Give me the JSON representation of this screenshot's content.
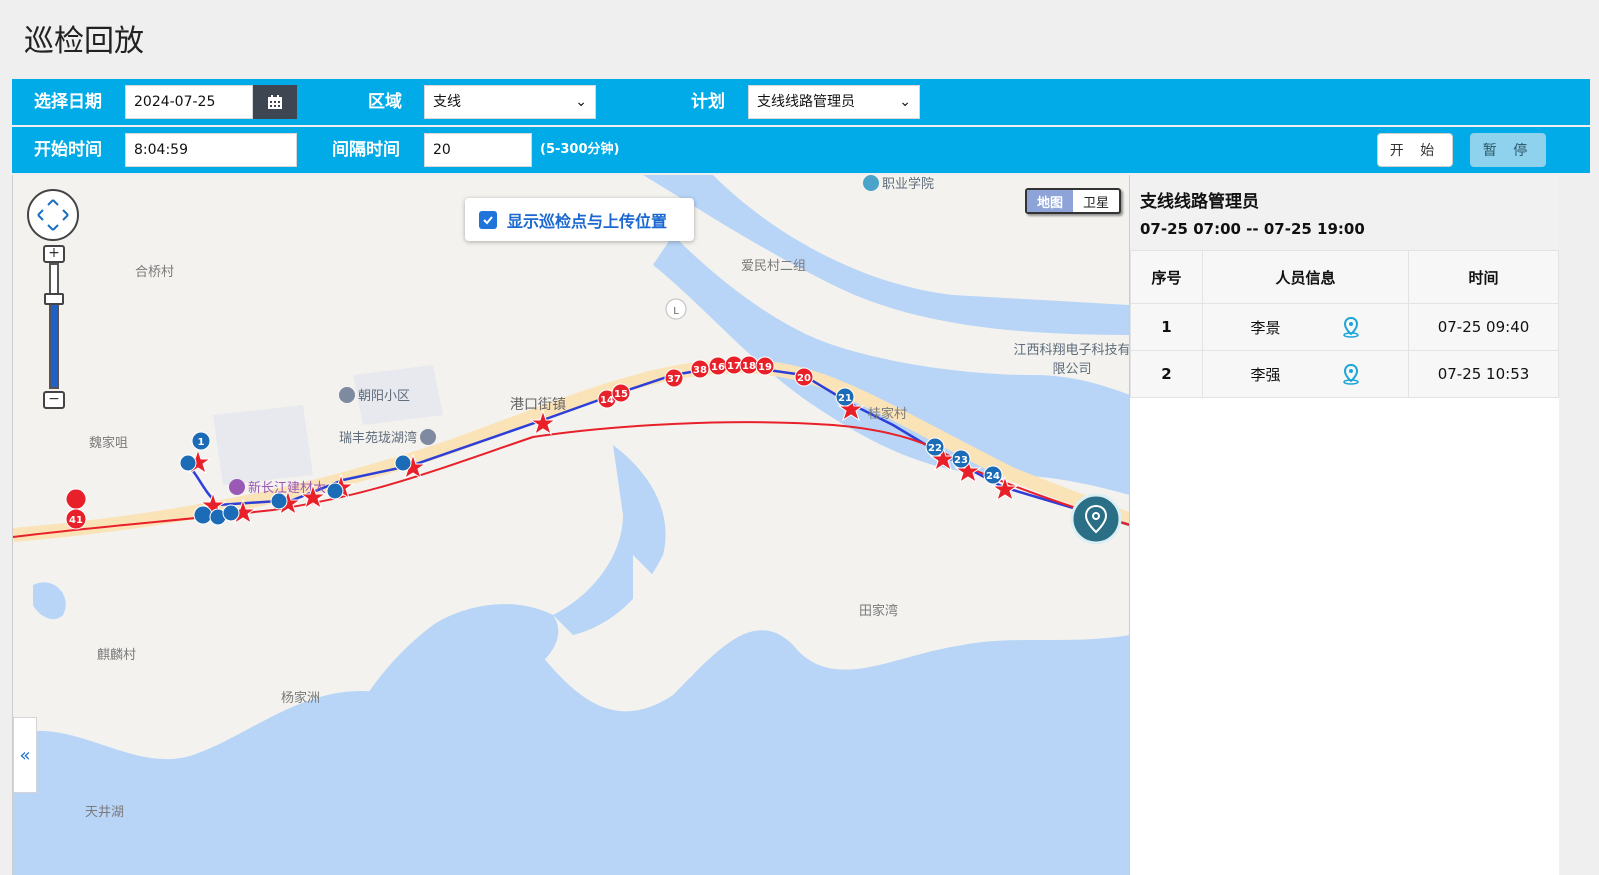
{
  "page_title": "巡检回放",
  "filters": {
    "date_label": "选择日期",
    "date_value": "2024-07-25",
    "area_label": "区域",
    "area_value": "支线",
    "plan_label": "计划",
    "plan_value": "支线线路管理员",
    "start_time_label": "开始时间",
    "start_time_value": "8:04:59",
    "interval_label": "间隔时间",
    "interval_value": "20",
    "interval_hint": "(5-300分钟)",
    "start_button": "开 始",
    "pause_button": "暂 停"
  },
  "map": {
    "legend_checkbox_label": "显示巡检点与上传位置",
    "map_type_options": [
      "地图",
      "卫星"
    ],
    "map_type_selected": "地图",
    "place_labels": [
      "合桥村",
      "爱民村二组",
      "朝阳小区",
      "瑞丰苑珑湖湾",
      "魏家咀",
      "港口街镇",
      "桂家村",
      "新长江建材大",
      "田家湾",
      "麒麟村",
      "杨家洲",
      "天井湖",
      "江西科翔电子科技有限公司",
      "职业学院"
    ],
    "route_point_labels": [
      "1",
      "14",
      "15",
      "37",
      "38",
      "16",
      "17",
      "18",
      "19",
      "20",
      "21",
      "22",
      "23",
      "24",
      "41"
    ],
    "colors": {
      "water": "#b8d5f7",
      "planned_route": "#2d3fd8",
      "actual_track": "#e8202a",
      "marker": "#e8202a",
      "blue_marker": "#1c6bb6"
    }
  },
  "panel": {
    "plan_name": "支线线路管理员",
    "time_range": "07-25 07:00 -- 07-25 19:00",
    "columns": [
      "序号",
      "人员信息",
      "时间"
    ],
    "rows": [
      {
        "index": "1",
        "name": "李景",
        "time": "07-25 09:40"
      },
      {
        "index": "2",
        "name": "李强",
        "time": "07-25 10:53"
      }
    ]
  }
}
